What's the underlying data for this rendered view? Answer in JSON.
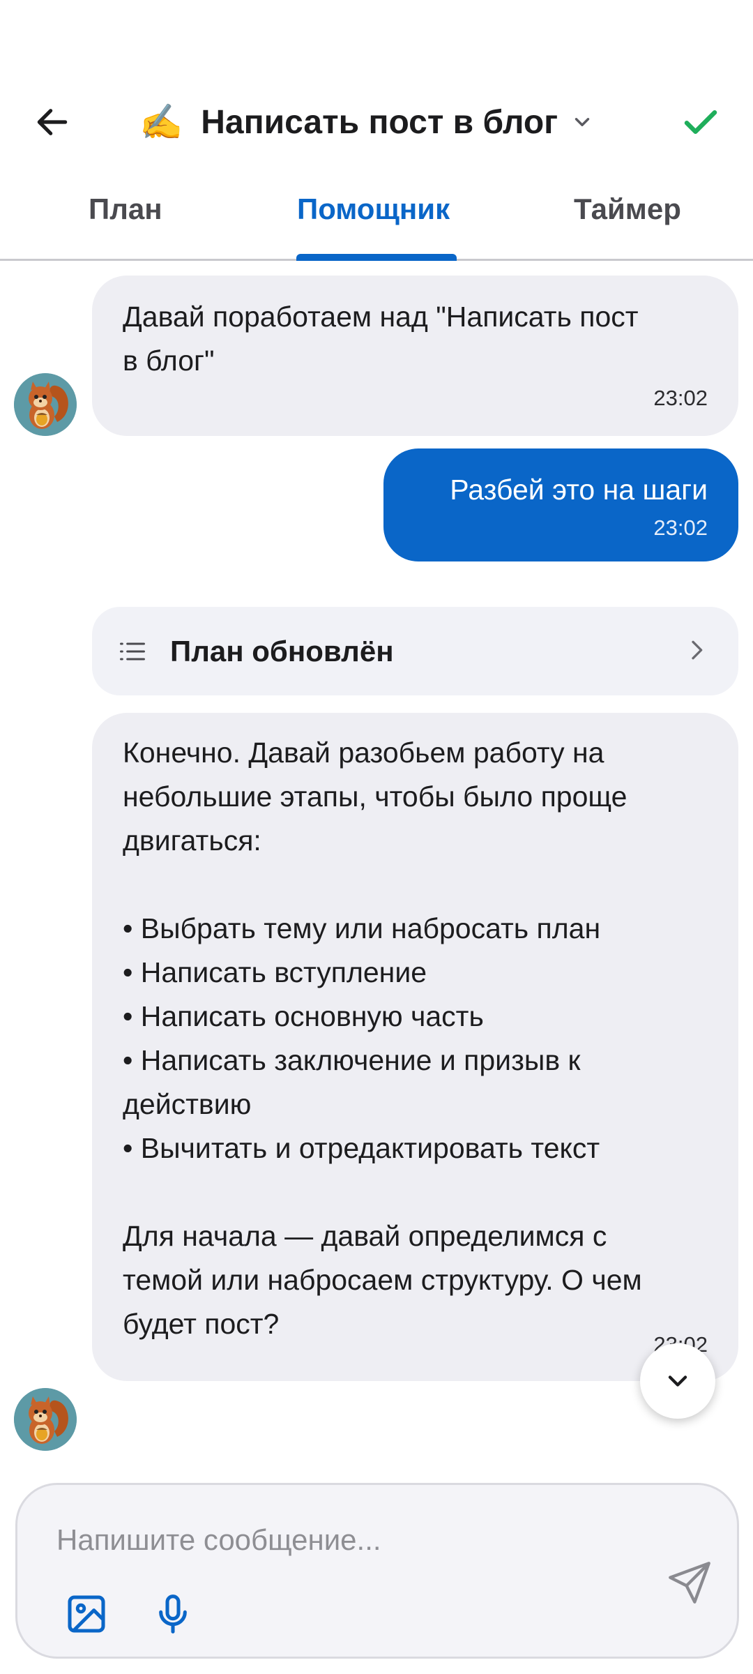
{
  "header": {
    "emoji": "✍️",
    "title": "Написать пост в блог"
  },
  "tabs": [
    {
      "label": "План",
      "active": false
    },
    {
      "label": "Помощник",
      "active": true
    },
    {
      "label": "Таймер",
      "active": false
    }
  ],
  "messages": [
    {
      "from": "assistant",
      "text": "Давай поработаем над \"Написать пост\nв блог\"",
      "time": "23:02"
    },
    {
      "from": "user",
      "text": "Разбей это на шаги",
      "time": "23:02"
    },
    {
      "from": "assistant",
      "text": "Конечно. Давай разобьем работу на\nнебольшие этапы, чтобы было проще\nдвигаться:\n\n• Выбрать тему или набросать план\n• Написать вступление\n• Написать основную часть\n• Написать заключение и призыв к\nдействию\n• Вычитать и отредактировать текст\n\nДля начала — давай определимся с\nтемой или набросаем структуру. О чем\nбудет пост?",
      "time": "23:02"
    }
  ],
  "plan_card": {
    "label": "План обновлён"
  },
  "composer": {
    "placeholder": "Напишите сообщение..."
  },
  "colors": {
    "accent": "#0a66c8",
    "check": "#1fae5b",
    "bubble_in": "#eeeef3"
  }
}
